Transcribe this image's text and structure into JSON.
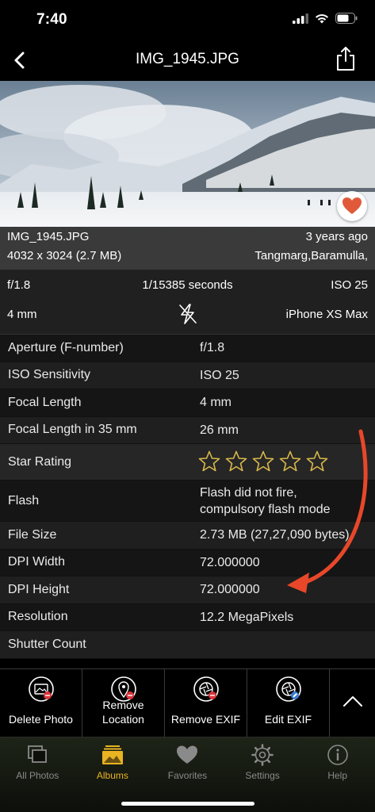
{
  "status_bar": {
    "time": "7:40"
  },
  "nav": {
    "title": "IMG_1945.JPG"
  },
  "photo_info": {
    "file_name": "IMG_1945.JPG",
    "age": "3 years ago",
    "dimensions": "4032 x 3024 (2.7 MB)",
    "location": "Tangmarg,Baramulla,"
  },
  "summary": {
    "aperture": "f/1.8",
    "shutter": "1/15385 seconds",
    "iso": "ISO 25",
    "focal": "4 mm",
    "camera": "iPhone XS Max"
  },
  "exif_rows": [
    {
      "key": "Aperture (F-number)",
      "value": "f/1.8"
    },
    {
      "key": "ISO Sensitivity",
      "value": "ISO 25"
    },
    {
      "key": "Focal Length",
      "value": "4 mm"
    },
    {
      "key": "Focal Length in 35 mm",
      "value": "26 mm"
    },
    {
      "key": "Star Rating",
      "value": ""
    },
    {
      "key": "Flash",
      "value_line1": "Flash did not fire,",
      "value_line2": "compulsory flash mode"
    },
    {
      "key": "File Size",
      "value": "2.73 MB (27,27,090 bytes)"
    },
    {
      "key": "DPI Width",
      "value": "72.000000"
    },
    {
      "key": "DPI Height",
      "value": "72.000000"
    },
    {
      "key": "Resolution",
      "value": "12.2 MegaPixels"
    },
    {
      "key": "Shutter Count",
      "value": ""
    }
  ],
  "star_rating": {
    "value": 0,
    "max": 5
  },
  "actions": [
    {
      "label": "Delete Photo",
      "icon": "delete-photo-icon"
    },
    {
      "label_line1": "Remove",
      "label_line2": "Location",
      "icon": "remove-location-icon"
    },
    {
      "label": "Remove EXIF",
      "icon": "remove-exif-icon"
    },
    {
      "label": "Edit EXIF",
      "icon": "edit-exif-icon"
    }
  ],
  "tabs": [
    {
      "label": "All Photos",
      "icon": "all-photos-icon"
    },
    {
      "label": "Albums",
      "icon": "albums-icon",
      "active": true
    },
    {
      "label": "Favorites",
      "icon": "heart-icon"
    },
    {
      "label": "Settings",
      "icon": "gear-icon"
    },
    {
      "label": "Help",
      "icon": "info-icon"
    }
  ],
  "colors": {
    "accent": "#e9b422",
    "annotation_arrow": "#e8472a",
    "heart": "#e05a3a",
    "star": "#d8b84a"
  }
}
